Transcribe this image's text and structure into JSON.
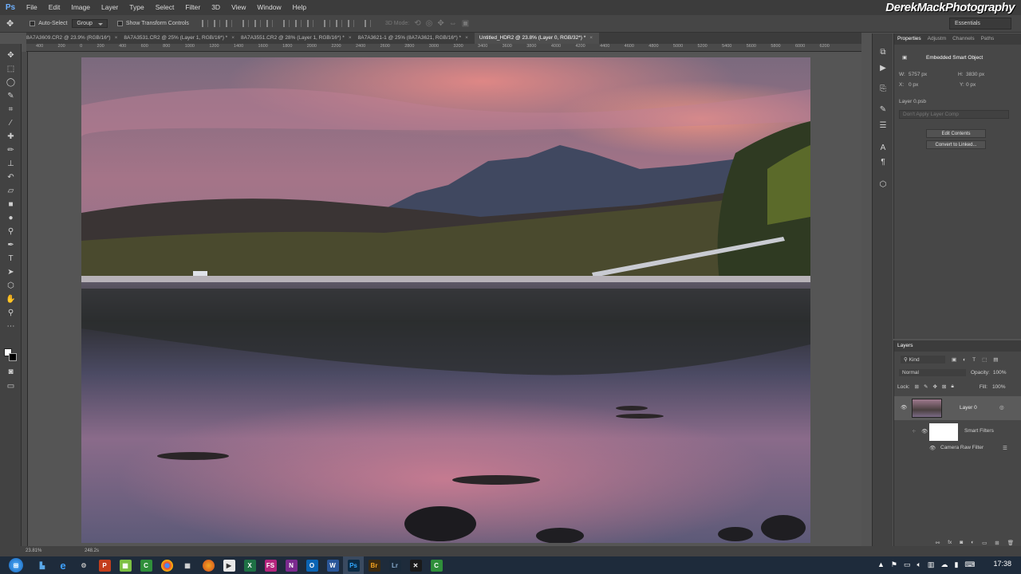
{
  "app": {
    "logo": "Ps",
    "watermark": "DerekMackPhotography"
  },
  "menu": [
    "File",
    "Edit",
    "Image",
    "Layer",
    "Type",
    "Select",
    "Filter",
    "3D",
    "View",
    "Window",
    "Help"
  ],
  "options": {
    "auto_select": "Auto-Select",
    "group": "Group",
    "show_transform": "Show Transform Controls",
    "mode_3d": "3D Mode:",
    "workspace": "Essentials"
  },
  "tabs": [
    {
      "label": "8A7A3609.CR2 @ 23.9% (RGB/16*)",
      "active": false
    },
    {
      "label": "8A7A3531.CR2 @ 25% (Layer 1, RGB/16*) *",
      "active": false
    },
    {
      "label": "8A7A3551.CR2 @ 28% (Layer 1, RGB/16*) *",
      "active": false
    },
    {
      "label": "8A7A3621-1 @ 25% (8A7A3621, RGB/16*) *",
      "active": false
    },
    {
      "label": "Untitled_HDR2 @ 23.8% (Layer 0, RGB/32*) *",
      "active": true
    }
  ],
  "ruler_ticks": [
    "400",
    "200",
    "0",
    "200",
    "400",
    "600",
    "800",
    "1000",
    "1200",
    "1400",
    "1600",
    "1800",
    "2000",
    "2200",
    "2400",
    "2600",
    "2800",
    "3000",
    "3200",
    "3400",
    "3600",
    "3800",
    "4000",
    "4200",
    "4400",
    "4600",
    "4800",
    "5000",
    "5200",
    "5400",
    "5600",
    "5800",
    "6000",
    "6200"
  ],
  "properties": {
    "tabs": [
      "Properties",
      "Adjustm",
      "Channels",
      "Paths"
    ],
    "header": "Embedded Smart Object",
    "w_label": "W:",
    "w_value": "5757 px",
    "h_label": "H:",
    "h_value": "3830 px",
    "x_label": "X:",
    "x_value": "0 px",
    "y_label": "Y:",
    "y_value": "0 px",
    "file": "Layer 0.psb",
    "layer_comp": "Don't Apply Layer Comp",
    "edit_contents": "Edit Contents",
    "convert_linked": "Convert to Linked..."
  },
  "layers": {
    "title": "Layers",
    "kind": "Kind",
    "blend": "Normal",
    "opacity_label": "Opacity:",
    "opacity": "100%",
    "lock_label": "Lock:",
    "fill_label": "Fill:",
    "fill": "100%",
    "layer_name": "Layer 0",
    "smart_filters": "Smart Filters",
    "filter_name": "Camera Raw Filter"
  },
  "status": {
    "zoom": "23.81%",
    "doc": "248.2s"
  },
  "clock": "17:38"
}
